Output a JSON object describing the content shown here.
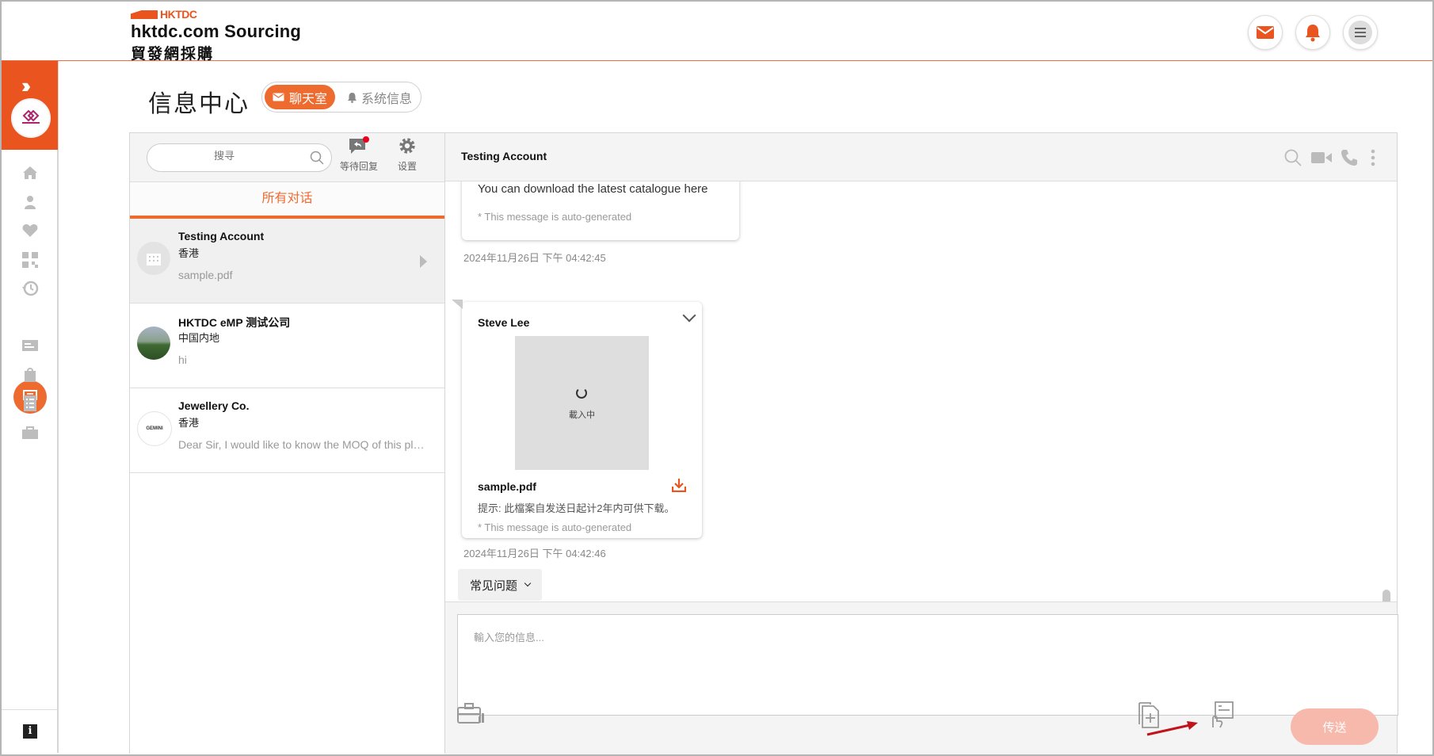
{
  "header": {
    "logo_small": "HKTDC",
    "logo_line1": "hktdc.com Sourcing",
    "logo_line2": "貿發網採購",
    "icons": [
      "mail-icon",
      "bell-icon",
      "menu-icon"
    ]
  },
  "sidebar": {
    "expand_icon": "double-chevron-right-icon",
    "nav_icons": [
      "home-icon",
      "user-icon",
      "heart-icon",
      "qr-code-icon",
      "history-icon",
      "chat-icon",
      "card-icon",
      "bag-icon",
      "list-icon",
      "briefcase-icon"
    ],
    "active": "chat-icon",
    "info_label": "i"
  },
  "page": {
    "title": "信息中心",
    "tab_chat": "聊天室",
    "tab_system": "系统信息"
  },
  "list": {
    "search_placeholder": "搜寻",
    "pending_label": "等待回复",
    "settings_label": "设置",
    "all_tab": "所有对话",
    "conversations": [
      {
        "name": "Testing Account",
        "location": "香港",
        "message": "sample.pdf"
      },
      {
        "name": "HKTDC eMP 测试公司",
        "location": "中国内地",
        "message": "hi"
      },
      {
        "name": "Jewellery Co.",
        "location": "香港",
        "message": "Dear Sir, I would like to know the MOQ of this platinum ring",
        "avatar_text": "GEMINI"
      }
    ]
  },
  "chat": {
    "title": "Testing Account",
    "msg1_text": "You can download the latest catalogue here",
    "msg1_auto": "* This message is auto-generated",
    "msg1_time": "2024年11月26日 下午 04:42:45",
    "msg2_sender": "Steve Lee",
    "msg2_loading": "載入中",
    "msg2_file": "sample.pdf",
    "msg2_hint": "提示: 此檔案自发送日起计2年内可供下载。",
    "msg2_auto": "* This message is auto-generated",
    "msg2_time": "2024年11月26日 下午 04:42:46",
    "faq_label": "常见问题",
    "input_placeholder": "輸入您的信息...",
    "send_label": "传送"
  },
  "colors": {
    "brand": "#e9541f",
    "accent": "#ee6b30",
    "send_disabled": "#f8b9ad",
    "annotation_arrow": "#c0141c"
  }
}
